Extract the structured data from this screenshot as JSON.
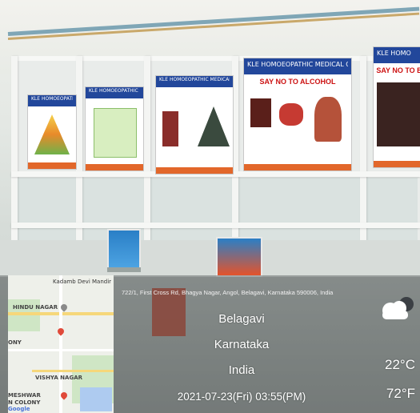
{
  "posters": [
    {
      "org": "KLE HOMOEOPATHIC MEDICAL COLLEGE",
      "sub": ""
    },
    {
      "org": "KLE HOMOEOPATHIC MEDICAL COLLEGE",
      "sub": ""
    },
    {
      "org": "KLE HOMOEOPATHIC MEDICAL COLLEGE",
      "sub": ""
    },
    {
      "org": "KLE HOMOEOPATHIC MEDICAL COLLEGE",
      "sub": "SAY NO TO ALCOHOL"
    },
    {
      "org": "KLE HOMO",
      "sub": "SAY NO TO BE"
    }
  ],
  "map": {
    "labels": [
      "Kadamb Devi Mandir",
      "HINDU NAGAR",
      "ONY",
      "VISHYA NAGAR",
      "MESHWAR",
      "N COLONY",
      "Google"
    ]
  },
  "geo": {
    "address": "722/1, First Cross Rd, Bhagya Nagar, Angol, Belagavi, Karnataka 590006, India",
    "city": "Belagavi",
    "state": "Karnataka",
    "country": "India",
    "datetime": "2021-07-23(Fri)  03:55(PM)",
    "temp_c": "22°C",
    "temp_f": "72°F",
    "weather": "cloudy-icon"
  },
  "colors": {
    "poster_header": "#22479b",
    "poster_footer": "#e2672a",
    "stand": "#2a7fc6"
  }
}
